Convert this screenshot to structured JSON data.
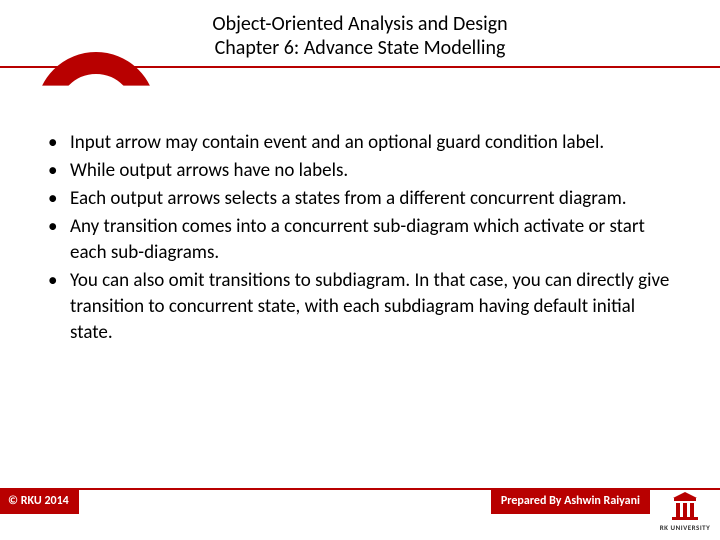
{
  "header": {
    "title_line1": "Object-Oriented Analysis and Design",
    "title_line2": "Chapter 6: Advance State Modelling"
  },
  "bullets": [
    "Input arrow may contain event and an optional guard condition label.",
    "While output arrows have no labels.",
    "Each output arrows selects a states from a different concurrent diagram.",
    "Any transition comes into a concurrent sub-diagram which activate or start each sub-diagrams.",
    "You can also omit transitions to subdiagram. In that case, you can directly give transition to concurrent state, with each subdiagram having default initial state."
  ],
  "footer": {
    "copyright": "© RKU 2014",
    "prepared_by": "Prepared By Ashwin Raiyani",
    "logo_text": "RK UNIVERSITY"
  },
  "colors": {
    "accent": "#b80000"
  }
}
